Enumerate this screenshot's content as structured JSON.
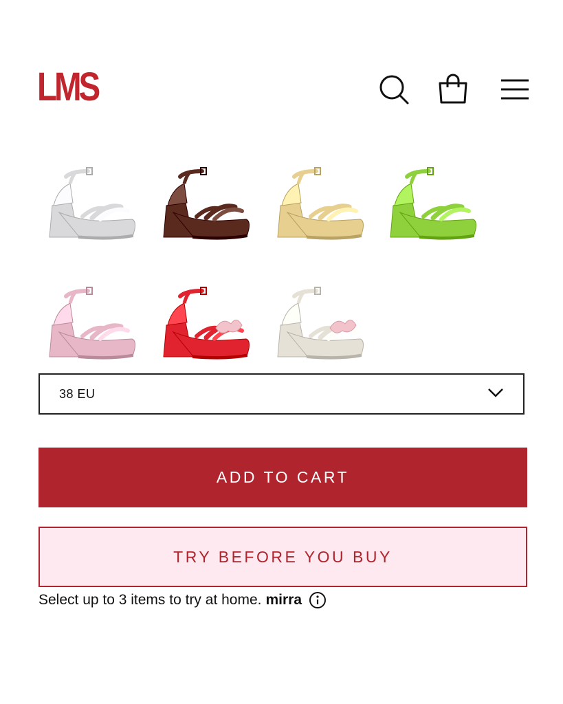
{
  "header": {
    "logo_text": "LMS",
    "icons": [
      "search-icon",
      "shopping-bag-icon",
      "hamburger-menu-icon"
    ]
  },
  "colors": {
    "brand": "#c1262e",
    "cta": "#b0242d",
    "try_bg": "#fde9ef"
  },
  "swatches": [
    {
      "name": "silver",
      "color": "#d9d9db"
    },
    {
      "name": "brown",
      "color": "#5a2a1e"
    },
    {
      "name": "gold",
      "color": "#e6cf8f"
    },
    {
      "name": "lime",
      "color": "#8fd13c"
    },
    {
      "name": "pink",
      "color": "#e7b7c7"
    },
    {
      "name": "red",
      "color": "#e0232e"
    },
    {
      "name": "cream",
      "color": "#e6e1d6"
    }
  ],
  "size_select": {
    "value": "38 EU"
  },
  "actions": {
    "add_to_cart": "ADD TO CART",
    "try_before": "TRY BEFORE YOU BUY"
  },
  "note": {
    "text": "Select up to 3 items to try at home.",
    "brand": "mirra"
  }
}
